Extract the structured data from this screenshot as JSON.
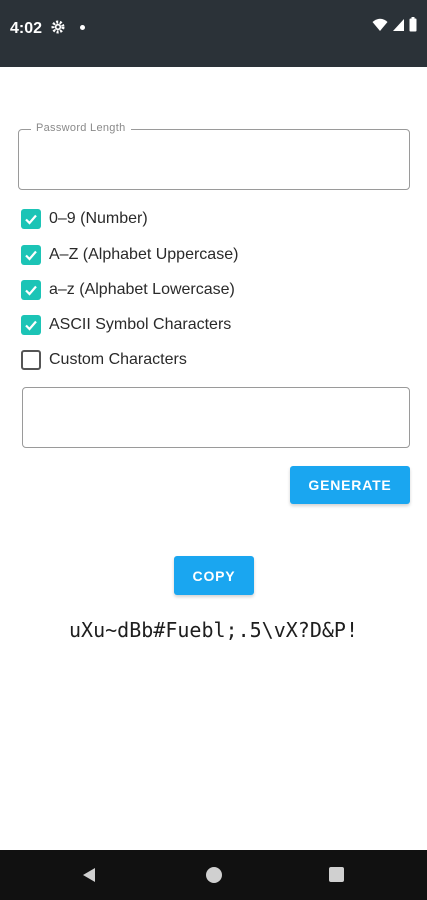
{
  "status_bar": {
    "time": "4:02"
  },
  "form": {
    "length_label": "Password Length",
    "length_value": "",
    "custom_value": ""
  },
  "options": [
    {
      "label": "0–9 (Number)",
      "checked": true
    },
    {
      "label": "A–Z (Alphabet Uppercase)",
      "checked": true
    },
    {
      "label": "a–z (Alphabet Lowercase)",
      "checked": true
    },
    {
      "label": "ASCII Symbol Characters",
      "checked": true
    },
    {
      "label": "Custom Characters",
      "checked": false
    }
  ],
  "buttons": {
    "generate": "GENERATE",
    "copy": "COPY"
  },
  "result": "uXu~dBb#Fuebl;.5\\vX?D&P!",
  "colors": {
    "accent": "#1cc4b6",
    "button": "#1aa6f0",
    "status_bar": "#2b3238"
  }
}
